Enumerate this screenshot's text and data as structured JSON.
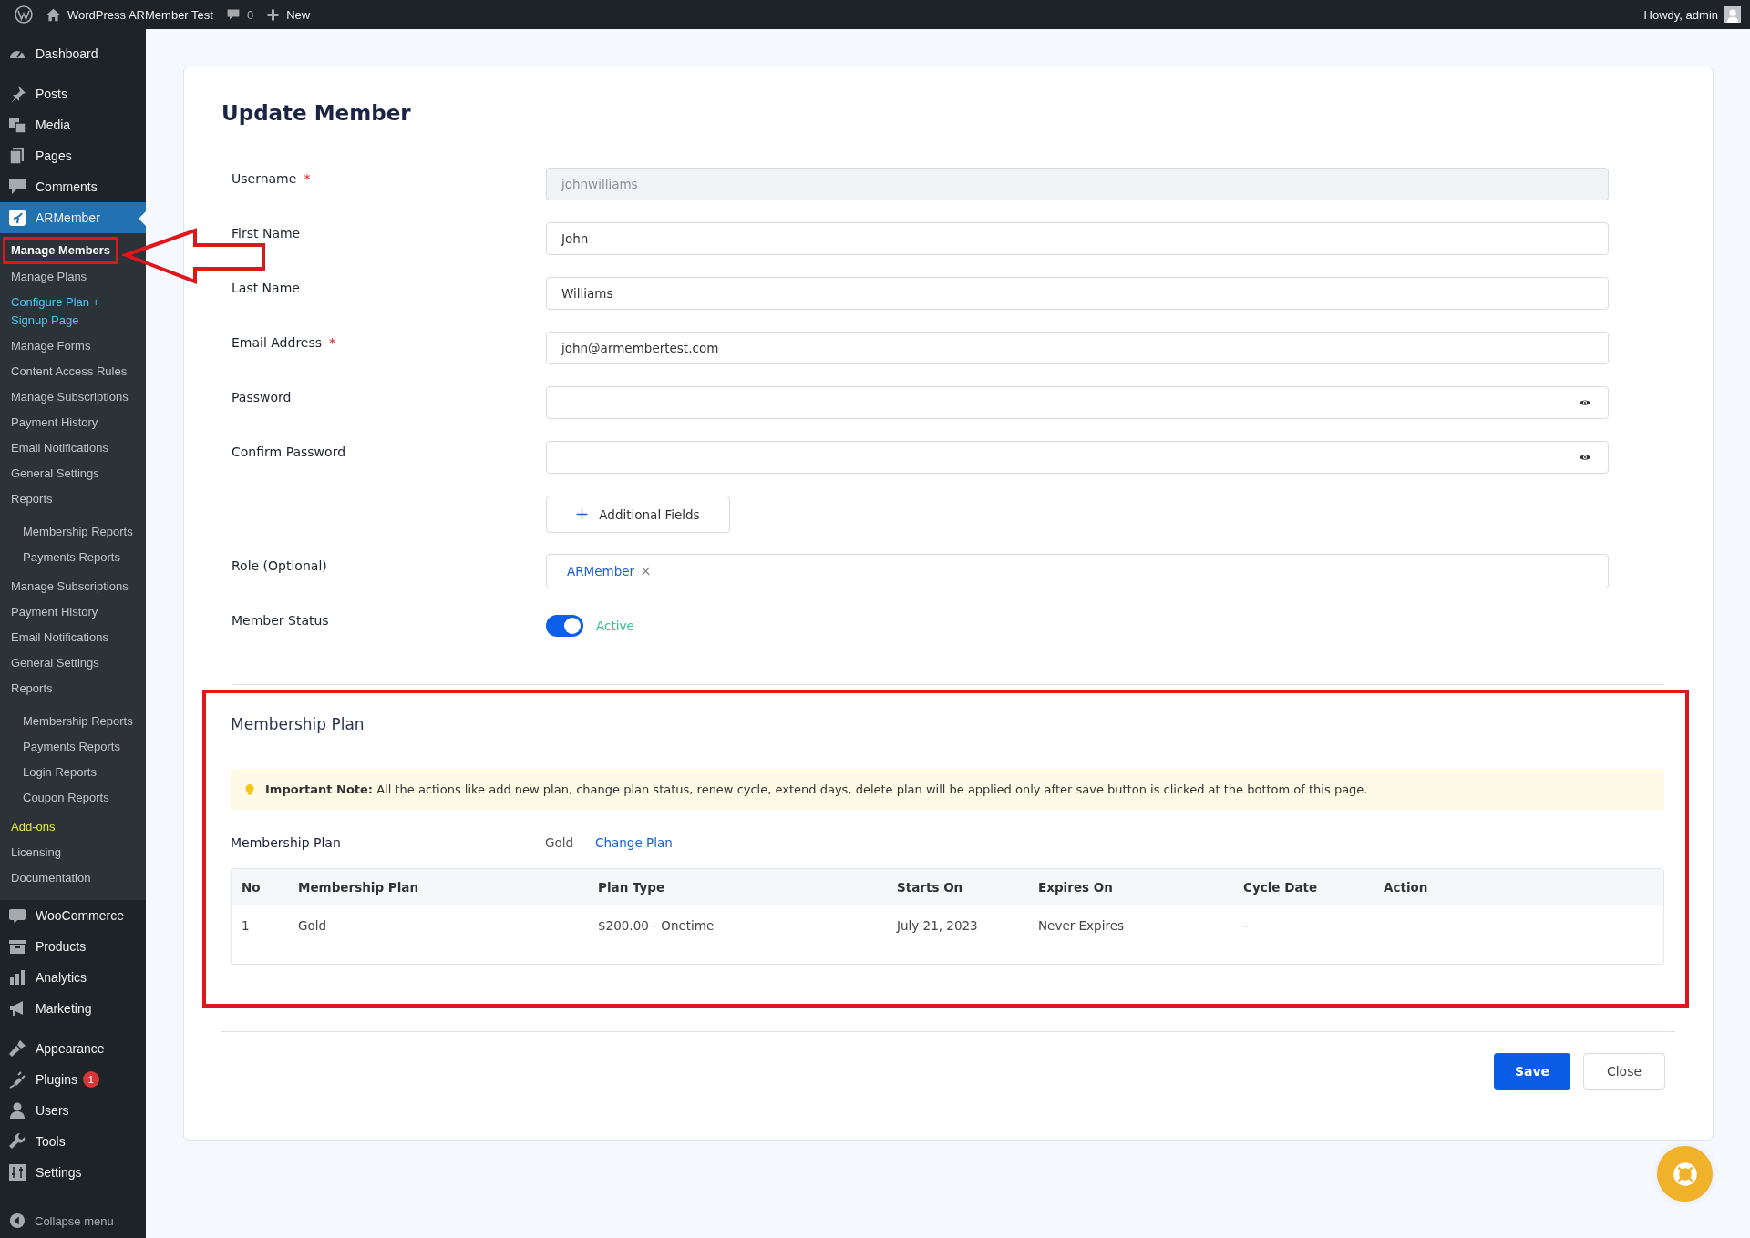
{
  "admin_bar": {
    "site_name": "WordPress ARMember Test",
    "comments_count": "0",
    "new_label": "New",
    "greeting": "Howdy, admin"
  },
  "sidebar": {
    "groups": [
      {
        "items": [
          {
            "label": "Dashboard",
            "selected": false
          }
        ]
      },
      {
        "items": [
          {
            "label": "Posts",
            "selected": false
          },
          {
            "label": "Media",
            "selected": false
          },
          {
            "label": "Pages",
            "selected": false
          },
          {
            "label": "Comments",
            "selected": false
          },
          {
            "label": "ARMember",
            "selected": true,
            "children": [
              {
                "label": "Manage Members",
                "selected": true,
                "highlighted": true,
                "color": "#ffffff"
              },
              {
                "label": "Manage Plans",
                "selected": false,
                "highlighted": false,
                "color": "#c3c4c7"
              },
              {
                "label": "Configure Plan + Signup Page",
                "selected": false,
                "highlighted": false,
                "color": "#4fc3f0"
              },
              {
                "label": "Manage Forms",
                "selected": false,
                "highlighted": false,
                "color": "#c3c4c7"
              },
              {
                "label": "Content Access Rules",
                "selected": false,
                "highlighted": false,
                "color": "#c3c4c7"
              },
              {
                "label": "Manage Subscriptions",
                "selected": false,
                "highlighted": false,
                "color": "#c3c4c7"
              },
              {
                "label": "Payment History",
                "selected": false,
                "highlighted": false,
                "color": "#c3c4c7"
              },
              {
                "label": "Email Notifications",
                "selected": false,
                "highlighted": false,
                "color": "#c3c4c7"
              },
              {
                "label": "General Settings",
                "selected": false,
                "highlighted": false,
                "color": "#c3c4c7"
              },
              {
                "label": "Reports",
                "selected": false,
                "highlighted": false,
                "color": "#c3c4c7",
                "children": [
                  {
                    "label": "Membership Reports",
                    "selected": false,
                    "highlighted": false,
                    "color": "#c3c4c7"
                  },
                  {
                    "label": "Payments Reports",
                    "selected": false,
                    "highlighted": false,
                    "color": "#c3c4c7"
                  }
                ]
              },
              {
                "label": "Manage Subscriptions",
                "selected": false,
                "highlighted": false,
                "color": "#c3c4c7"
              },
              {
                "label": "Payment History",
                "selected": false,
                "highlighted": false,
                "color": "#c3c4c7"
              },
              {
                "label": "Email Notifications",
                "selected": false,
                "highlighted": false,
                "color": "#c3c4c7"
              },
              {
                "label": "General Settings",
                "selected": false,
                "highlighted": false,
                "color": "#c3c4c7"
              },
              {
                "label": "Reports",
                "selected": false,
                "highlighted": false,
                "color": "#c3c4c7",
                "children": [
                  {
                    "label": "Membership Reports",
                    "selected": false,
                    "highlighted": false,
                    "color": "#c3c4c7"
                  },
                  {
                    "label": "Payments Reports",
                    "selected": false,
                    "highlighted": false,
                    "color": "#c3c4c7"
                  },
                  {
                    "label": "Login Reports",
                    "selected": false,
                    "highlighted": false,
                    "color": "#c3c4c7"
                  },
                  {
                    "label": "Coupon Reports",
                    "selected": false,
                    "highlighted": false,
                    "color": "#c3c4c7"
                  }
                ]
              },
              {
                "label": "Add-ons",
                "selected": false,
                "highlighted": false,
                "color": "#e6e83a"
              },
              {
                "label": "Licensing",
                "selected": false,
                "highlighted": false,
                "color": "#c3c4c7"
              },
              {
                "label": "Documentation",
                "selected": false,
                "highlighted": false,
                "color": "#c3c4c7"
              }
            ]
          }
        ]
      },
      {
        "items": [
          {
            "label": "WooCommerce",
            "selected": false
          },
          {
            "label": "Products",
            "selected": false
          },
          {
            "label": "Analytics",
            "selected": false
          },
          {
            "label": "Marketing",
            "selected": false
          }
        ]
      },
      {
        "items": [
          {
            "label": "Appearance",
            "selected": false
          },
          {
            "label": "Plugins",
            "selected": false,
            "badge": "1"
          },
          {
            "label": "Users",
            "selected": false
          },
          {
            "label": "Tools",
            "selected": false
          },
          {
            "label": "Settings",
            "selected": false
          }
        ]
      }
    ],
    "collapse_label": "Collapse menu"
  },
  "page": {
    "title": "Update Member",
    "fields": [
      {
        "label": "Username",
        "required_mark": "*",
        "kind": "text",
        "value": "johnwilliams",
        "disabled": true
      },
      {
        "label": "First Name",
        "kind": "text",
        "value": "John",
        "disabled": false
      },
      {
        "label": "Last Name",
        "kind": "text",
        "value": "Williams",
        "disabled": false
      },
      {
        "label": "Email Address",
        "required_mark": "*",
        "kind": "text",
        "value": "john@armembertest.com",
        "disabled": false
      },
      {
        "label": "Password",
        "kind": "password"
      },
      {
        "label": "Confirm Password",
        "kind": "password"
      }
    ],
    "additional_fields_button": "Additional Fields",
    "role": {
      "label": "Role (Optional)",
      "tags": [
        {
          "label": "ARMember",
          "remove": "×"
        }
      ]
    },
    "member_status": {
      "label": "Member Status",
      "on": true,
      "state_text": "Active"
    },
    "membership": {
      "title": "Membership Plan",
      "highlighted": true,
      "note": "**Important Note:** All the actions like add new plan, change plan status, renew cycle, extend days, delete plan will be applied only after save button is clicked at the bottom of this page.",
      "plan_label": "Membership Plan",
      "plan_value": "Gold",
      "change_link": "Change Plan",
      "table": {
        "columns": [
          "No",
          "Membership Plan",
          "Plan Type",
          "Starts On",
          "Expires On",
          "Cycle Date",
          "Action"
        ],
        "rows": [
          [
            "1",
            "Gold",
            "$200.00 - Onetime",
            "July 21, 2023",
            "Never Expires",
            "-",
            ""
          ]
        ]
      }
    },
    "buttons": {
      "save": "Save",
      "close": "Close"
    }
  }
}
